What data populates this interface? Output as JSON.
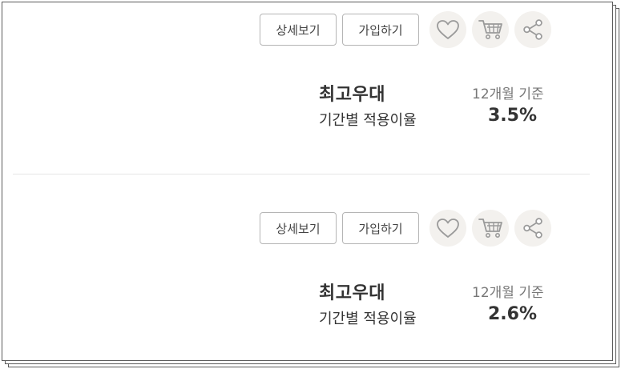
{
  "products": [
    {
      "detail_label": "상세보기",
      "join_label": "가입하기",
      "title": "최고우대",
      "subtitle": "기간별 적용이율",
      "period": "12개월 기준",
      "rate": "3.5%"
    },
    {
      "detail_label": "상세보기",
      "join_label": "가입하기",
      "title": "최고우대",
      "subtitle": "기간별 적용이율",
      "period": "12개월 기준",
      "rate": "2.6%"
    }
  ],
  "icons": {
    "favorite": "heart-icon",
    "cart": "cart-icon",
    "share": "share-icon"
  },
  "colors": {
    "icon_circle_bg": "#f3f1ee",
    "icon_stroke": "#9a9a9a",
    "text_dark": "#333333",
    "text_muted": "#777777",
    "button_border": "#b5b5b5"
  }
}
